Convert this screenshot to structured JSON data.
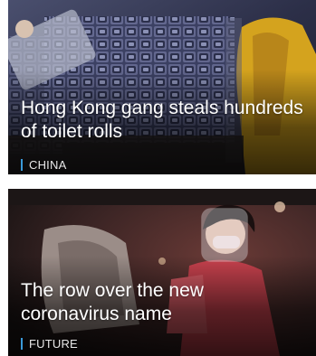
{
  "cards": [
    {
      "headline": "Hong Kong gang steals hundreds of toilet rolls",
      "tag": "CHINA",
      "image_icon": "toilet-rolls-photo"
    },
    {
      "headline": "The row over the new coronavirus name",
      "tag": "FUTURE",
      "image_icon": "child-face-shield-photo"
    }
  ],
  "colors": {
    "tag_accent": "#3a9ad9",
    "headline_text": "#ffffff"
  }
}
